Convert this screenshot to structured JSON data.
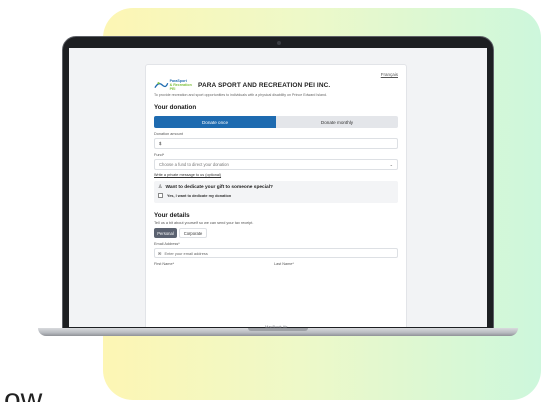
{
  "cut_text": "ow",
  "device": {
    "label": "MacBook Air"
  },
  "page": {
    "language_link": "Français",
    "logo_text_line1": "ParaSport",
    "logo_text_line2": "& Recreation PEI",
    "org_name": "PARA SPORT AND RECREATION PEI INC.",
    "tagline": "To provide recreation and sport opportunities to individuals with a physical disability on Prince Edward Island.",
    "donation": {
      "heading": "Your donation",
      "once_label": "Donate once",
      "monthly_label": "Donate monthly",
      "amount_label": "Donation amount",
      "amount_value": "$",
      "fund_label": "Fund*",
      "fund_placeholder": "Choose a fund to direct your donation",
      "private_message_link": "Write a private message to us (optional)",
      "dedicate_title": "Want to dedicate your gift to someone special?",
      "dedicate_checkbox_label": "Yes, I want to dedicate my donation"
    },
    "details": {
      "heading": "Your details",
      "subtitle": "Tell us a bit about yourself so we can send your tax receipt.",
      "personal_label": "Personal",
      "corporate_label": "Corporate",
      "email_label": "Email Address*",
      "email_placeholder": "Enter your email address",
      "first_name_label": "First Name*",
      "last_name_label": "Last Name*"
    }
  },
  "colors": {
    "primary": "#1e6bb0",
    "gradient_left": "#fdf6b4",
    "gradient_right": "#cdf7dc"
  },
  "icons": {
    "chevron": "chevron-down-icon",
    "mail": "mail-icon",
    "gift": "gift-person-icon"
  }
}
